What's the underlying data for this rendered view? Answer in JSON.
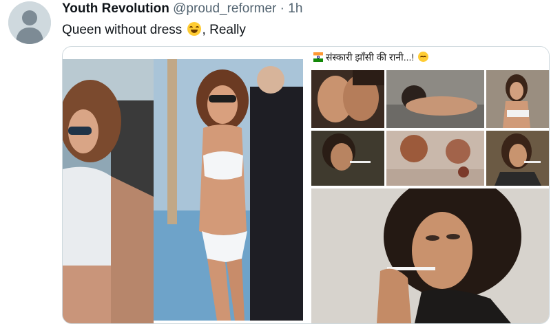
{
  "tweet": {
    "display_name": "Youth Revolution",
    "handle": "@proud_reformer",
    "separator": "·",
    "time": "1h",
    "text": "Queen without dress",
    "text_suffix": ", Really",
    "emoji": "rolling-on-floor-laughing-emoji"
  },
  "media": {
    "collage_caption": "संस्कारी झाँसी की रानी...!",
    "caption_emoji": "laughing-emoji",
    "photos": [
      {
        "name": "photo-beach-closeup"
      },
      {
        "name": "photo-white-bikini"
      },
      {
        "name": "photo-collage-thumb-1"
      },
      {
        "name": "photo-collage-thumb-2"
      },
      {
        "name": "photo-collage-thumb-3"
      },
      {
        "name": "photo-collage-thumb-4"
      },
      {
        "name": "photo-collage-thumb-5"
      },
      {
        "name": "photo-collage-thumb-6"
      },
      {
        "name": "photo-smoking-portrait"
      }
    ]
  },
  "colors": {
    "name": "#0f1419",
    "secondary": "#536471",
    "border": "#cfd9de"
  }
}
